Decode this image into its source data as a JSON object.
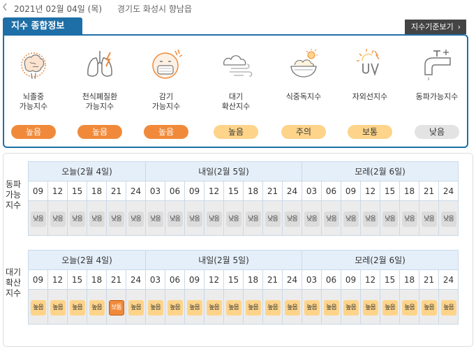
{
  "header": {
    "date": "2021년 02월 04일 (목)",
    "location": "경기도 화성시 향남읍"
  },
  "tab_label": "지수 종합정보",
  "criteria_button": "지수기준보기",
  "criteria_arrow": "›",
  "colors": {
    "primary": "#1e6fa7",
    "high": "#f08a3a",
    "caution": "#fdd48a",
    "low": "#e3e3e3"
  },
  "indices": [
    {
      "icon": "brain-icon",
      "line1": "뇌졸중",
      "line2": "가능지수",
      "level": "높음"
    },
    {
      "icon": "lungs-icon",
      "line1": "천식폐질환",
      "line2": "가능지수",
      "level": "높음"
    },
    {
      "icon": "mask-face-icon",
      "line1": "감기",
      "line2": "가능지수",
      "level": "높음"
    },
    {
      "icon": "wind-icon",
      "line1": "대기",
      "line2": "확산지수",
      "level": "높음"
    },
    {
      "icon": "food-bowl-icon",
      "line1": "식중독지수",
      "line2": "",
      "level": "주의"
    },
    {
      "icon": "uv-sun-icon",
      "line1": "자외선지수",
      "line2": "",
      "level": "보통"
    },
    {
      "icon": "faucet-icon",
      "line1": "동파가능지수",
      "line2": "",
      "level": "낮음"
    }
  ],
  "days": [
    "오늘(2월 4일)",
    "내일(2월 5일)",
    "모레(2월 6일)"
  ],
  "hours_today": [
    "09",
    "12",
    "15",
    "18",
    "21",
    "24"
  ],
  "hours_full": [
    "03",
    "06",
    "09",
    "12",
    "15",
    "18",
    "21",
    "24"
  ],
  "forecast": [
    {
      "label": [
        "동파",
        "가능",
        "지수"
      ],
      "today": [
        "낮음",
        "낮음",
        "낮음",
        "낮음",
        "낮음",
        "낮음"
      ],
      "tomorrow": [
        "낮음",
        "낮음",
        "낮음",
        "낮음",
        "낮음",
        "낮음",
        "낮음",
        "낮음"
      ],
      "dayafter": [
        "낮음",
        "낮음",
        "낮음",
        "낮음",
        "낮음",
        "낮음",
        "낮음",
        "낮음"
      ]
    },
    {
      "label": [
        "대기",
        "확산",
        "지수"
      ],
      "today": [
        "높음",
        "높음",
        "높음",
        "높음",
        "보통",
        "높음"
      ],
      "tomorrow": [
        "높음",
        "높음",
        "높음",
        "높음",
        "높음",
        "높음",
        "높음",
        "높음"
      ],
      "dayafter": [
        "높음",
        "높음",
        "높음",
        "높음",
        "높음",
        "높음",
        "높음",
        "높음"
      ]
    }
  ]
}
